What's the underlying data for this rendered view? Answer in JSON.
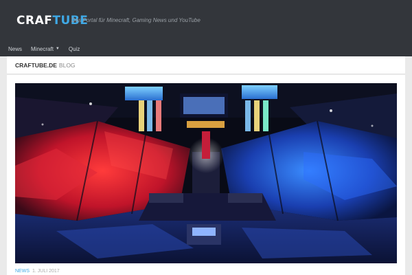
{
  "header": {
    "logo_part1": "CRAF",
    "logo_part2": "TUBE",
    "tagline": "Das Portal für Minecraft, Gaming News und YouTube"
  },
  "nav": {
    "items": [
      {
        "label": "News"
      },
      {
        "label": "Minecraft"
      },
      {
        "label": "Quiz"
      }
    ]
  },
  "titlebar": {
    "site": "CRAFTUBE.DE",
    "section": "BLOG"
  },
  "post": {
    "category": "NEWS",
    "date": "1. JULI 2017"
  },
  "colors": {
    "header_bg": "#33363b",
    "accent": "#3fa9e6",
    "page_bg": "#eaeaea"
  },
  "icons": {
    "dropdown": "chevron-down-icon"
  }
}
